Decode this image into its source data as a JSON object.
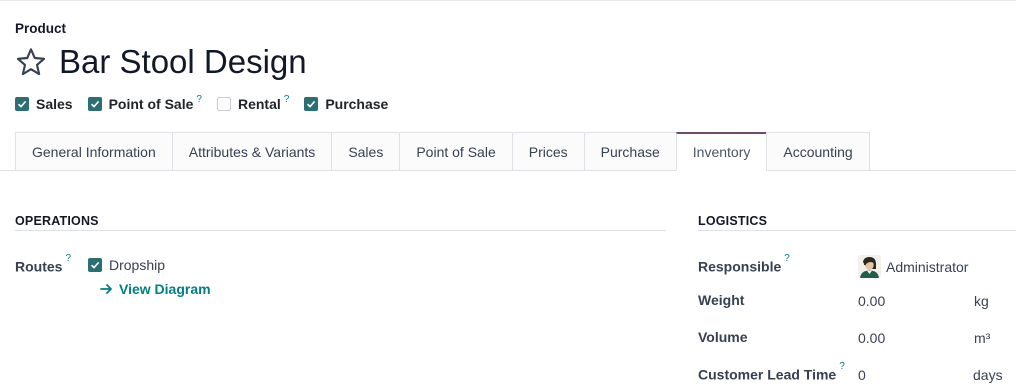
{
  "breadcrumb": {
    "label": "Product"
  },
  "product": {
    "name": "Bar Stool Design"
  },
  "options": [
    {
      "label": "Sales",
      "checked": true,
      "help": ""
    },
    {
      "label": "Point of Sale",
      "checked": true,
      "help": "?"
    },
    {
      "label": "Rental",
      "checked": false,
      "help": "?"
    },
    {
      "label": "Purchase",
      "checked": true,
      "help": ""
    }
  ],
  "tabs": [
    {
      "label": "General Information"
    },
    {
      "label": "Attributes & Variants"
    },
    {
      "label": "Sales"
    },
    {
      "label": "Point of Sale"
    },
    {
      "label": "Prices"
    },
    {
      "label": "Purchase"
    },
    {
      "label": "Inventory"
    },
    {
      "label": "Accounting"
    }
  ],
  "active_tab": "Inventory",
  "operations": {
    "title": "OPERATIONS",
    "routes_label": "Routes",
    "routes_help": "?",
    "route_option": "Dropship",
    "route_checked": true,
    "view_diagram": "View Diagram"
  },
  "logistics": {
    "title": "LOGISTICS",
    "responsible_label": "Responsible",
    "responsible_help": "?",
    "responsible_value": "Administrator",
    "weight_label": "Weight",
    "weight_value": "0.00",
    "weight_unit": "kg",
    "volume_label": "Volume",
    "volume_value": "0.00",
    "volume_unit": "m³",
    "lead_time_label": "Customer Lead Time",
    "lead_time_help": "?",
    "lead_time_value": "0",
    "lead_time_unit": "days"
  },
  "colors": {
    "accent": "#714b67",
    "checkbox": "#2d6e73",
    "link": "#017e84"
  },
  "icons": {
    "star": "star-outline-icon",
    "checkbox": "check-icon",
    "arrow": "arrow-right-icon"
  }
}
